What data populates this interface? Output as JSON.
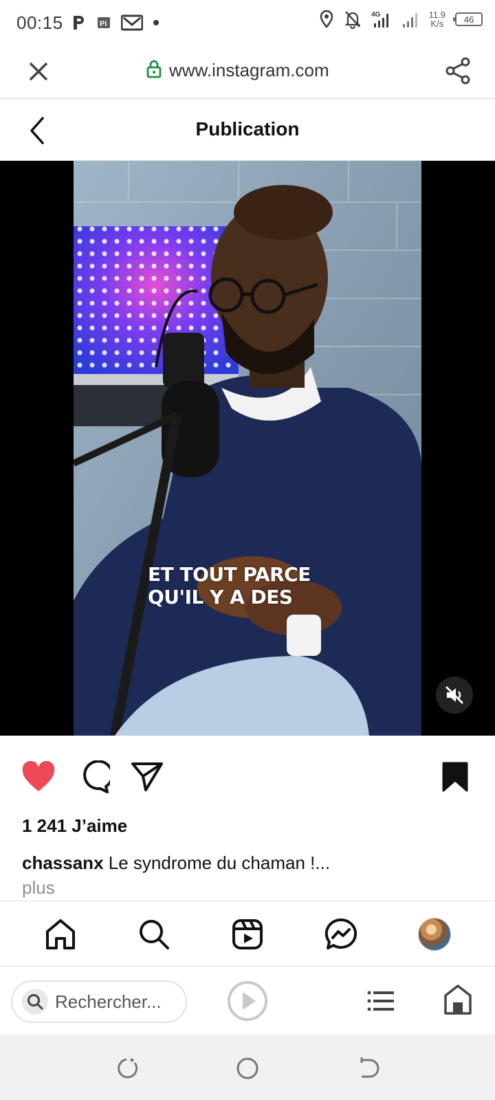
{
  "status": {
    "time": "00:15",
    "net_speed_value": "11.9",
    "net_speed_unit": "K/s",
    "network": "4G",
    "battery": "46"
  },
  "browser": {
    "url": "www.instagram.com"
  },
  "post": {
    "header_title": "Publication",
    "video_caption_line1": "ET TOUT PARCE",
    "video_caption_line2": "QU'IL Y A DES",
    "likes_text": "1 241 J’aime",
    "author": "chassanx",
    "caption_text": "Le syndrome du chaman !...",
    "more_label": "plus",
    "liked": true,
    "saved": true
  },
  "bottom_browser": {
    "search_placeholder": "Rechercher..."
  },
  "colors": {
    "like_red": "#ed4956",
    "secure_green": "#1e8e3e",
    "sweater_navy": "#1d2a55"
  },
  "icons": {
    "status_left": [
      "p-icon",
      "pi-icon",
      "gmail-icon",
      "dot-icon"
    ],
    "status_right": [
      "location-icon",
      "mute-bell-icon",
      "signal-4g-icon",
      "signal-icon",
      "battery-icon"
    ],
    "actions": [
      "heart-icon",
      "comment-icon",
      "share-icon",
      "bookmark-icon"
    ],
    "nav": [
      "home-icon",
      "search-icon",
      "reels-icon",
      "messenger-icon",
      "avatar"
    ]
  }
}
